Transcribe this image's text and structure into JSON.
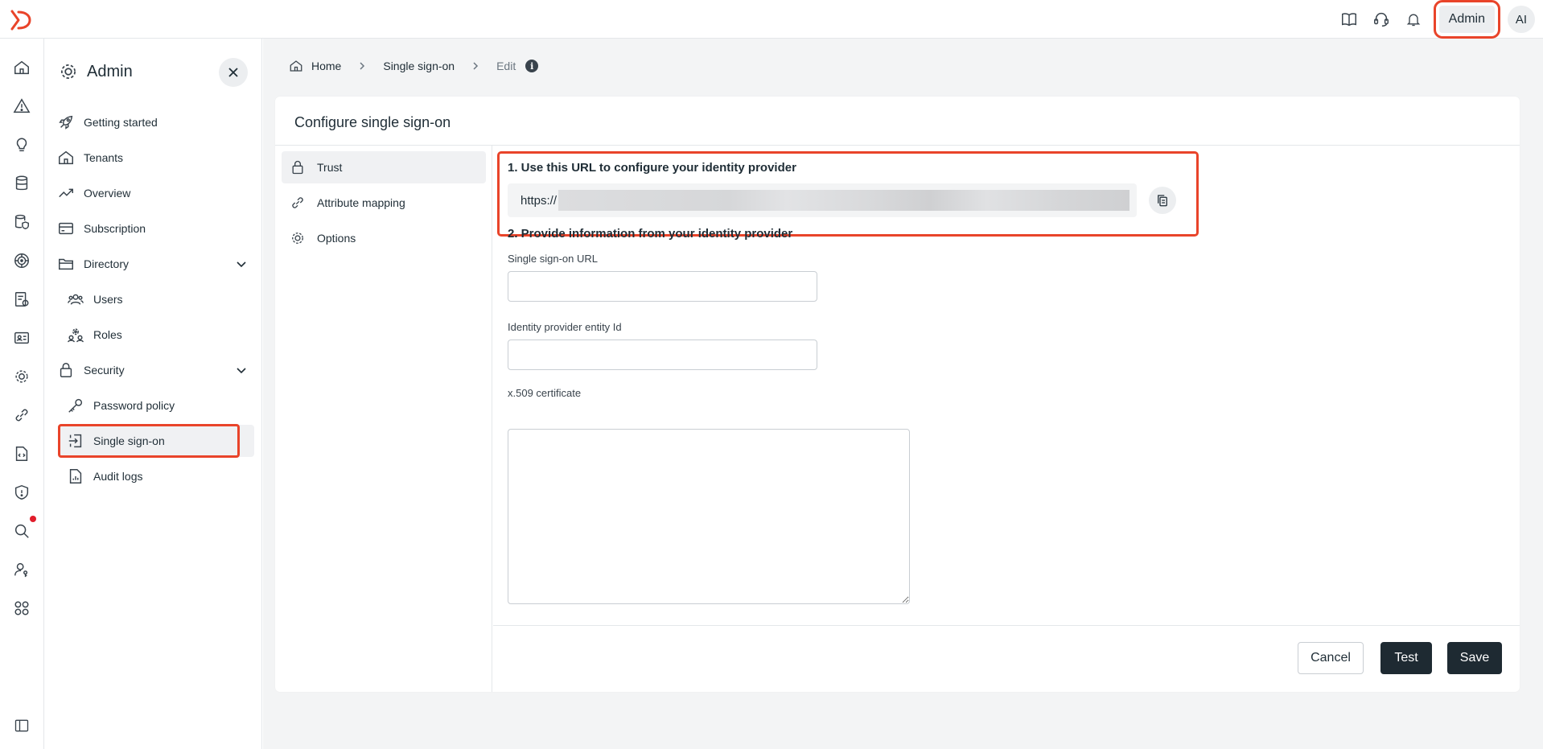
{
  "topbar": {
    "logo_icon": "product-logo",
    "icons": [
      "book-icon",
      "headset-icon",
      "bell-icon"
    ],
    "admin_label": "Admin",
    "avatar_initials": "AI",
    "accent_color": "#e9442a"
  },
  "rail": {
    "icons": [
      "home-icon",
      "alert-icon",
      "lightbulb-icon",
      "database-icon",
      "database-shield-icon",
      "radar-icon",
      "report-icon",
      "id-card-icon",
      "gear-icon",
      "link-icon",
      "code-file-icon",
      "shield-icon",
      "search-icon",
      "user-key-icon",
      "modules-icon",
      "panel-toggle-icon"
    ],
    "notification_color": "#e11d2b"
  },
  "sidebar": {
    "title": "Admin",
    "items": {
      "getting_started": "Getting started",
      "tenants": "Tenants",
      "overview": "Overview",
      "subscription": "Subscription",
      "directory": "Directory",
      "users": "Users",
      "roles": "Roles",
      "security": "Security",
      "password_policy": "Password policy",
      "single_sign_on": "Single sign-on",
      "audit_logs": "Audit logs"
    }
  },
  "breadcrumb": {
    "home": "Home",
    "section": "Single sign-on",
    "current": "Edit",
    "info": "i"
  },
  "card": {
    "title": "Configure single sign-on",
    "subnav": {
      "trust": "Trust",
      "attribute_mapping": "Attribute mapping",
      "options": "Options"
    },
    "step1": {
      "title": "1. Use this URL to configure your identity provider",
      "url_prefix": "https://"
    },
    "step2": {
      "title": "2. Provide information from your identity provider",
      "sso_url_label": "Single sign-on URL",
      "sso_url_value": "",
      "entity_id_label": "Identity provider entity Id",
      "entity_id_value": "",
      "certificate_label": "x.509 certificate",
      "certificate_value": ""
    },
    "buttons": {
      "cancel": "Cancel",
      "test": "Test",
      "save": "Save"
    }
  }
}
